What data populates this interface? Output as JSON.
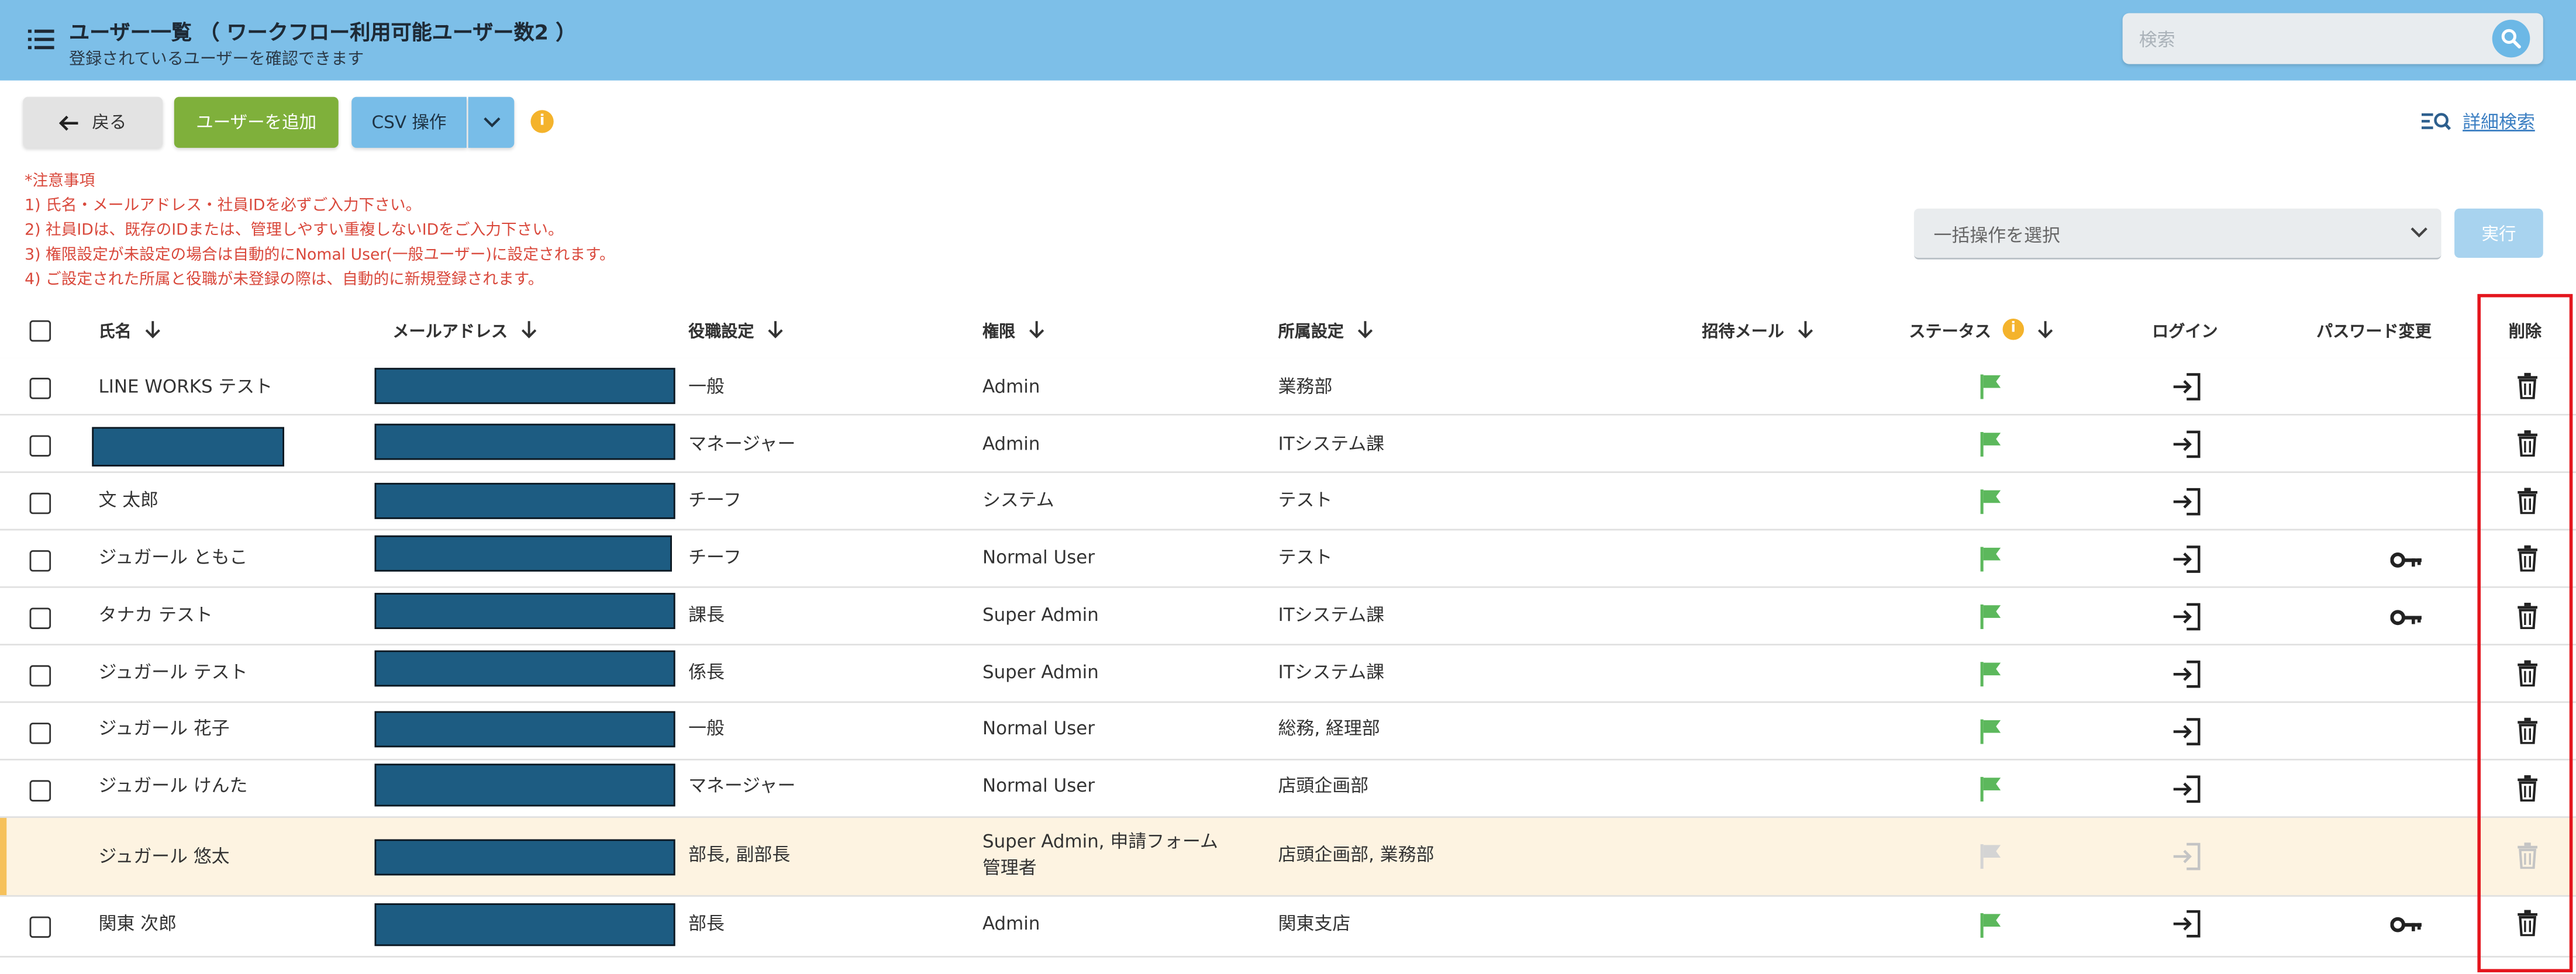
{
  "header": {
    "title": "ユーザー一覧 （ ワークフロー利用可能ユーザー数2 ）",
    "subtitle": "登録されているユーザーを確認できます",
    "search_placeholder": "検索"
  },
  "toolbar": {
    "back_label": "戻る",
    "add_user_label": "ユーザーを追加",
    "csv_label": "CSV 操作",
    "info_glyph": "i",
    "advanced_search_label": "詳細検索"
  },
  "notes": [
    "*注意事項",
    "1) 氏名・メールアドレス・社員IDを必ずご入力下さい。",
    "2) 社員IDは、既存のIDまたは、管理しやすい重複しないIDをご入力下さい。",
    "3) 権限設定が未設定の場合は自動的にNomal User(一般ユーザー)に設定されます。",
    "4) ご設定された所属と役職が未登録の際は、自動的に新規登録されます。"
  ],
  "bulk": {
    "selected": "一括操作を選択",
    "run_label": "実行"
  },
  "columns": {
    "name": "氏名",
    "email": "メールアドレス",
    "position": "役職設定",
    "role": "権限",
    "department": "所属設定",
    "invite": "招待メール",
    "status": "ステータス",
    "login": "ログイン",
    "password": "パスワード変更",
    "delete": "削除"
  },
  "rows": [
    {
      "name": "LINE WORKS テスト",
      "name_redacted": false,
      "position": "一般",
      "role": [
        "Admin"
      ],
      "department": "業務部",
      "password_key": false,
      "disabled": false
    },
    {
      "name": "",
      "name_redacted": true,
      "position": "マネージャー",
      "role": [
        "Admin"
      ],
      "department": "ITシステム課",
      "password_key": false,
      "disabled": false
    },
    {
      "name": "文 太郎",
      "name_redacted": false,
      "position": "チーフ",
      "role": [
        "システム"
      ],
      "department": "テスト",
      "password_key": false,
      "disabled": false
    },
    {
      "name": "ジュガール ともこ",
      "name_redacted": false,
      "position": "チーフ",
      "role": [
        "Normal User"
      ],
      "department": "テスト",
      "password_key": true,
      "disabled": false
    },
    {
      "name": "タナカ テスト",
      "name_redacted": false,
      "position": "課長",
      "role": [
        "Super Admin"
      ],
      "department": "ITシステム課",
      "password_key": true,
      "disabled": false
    },
    {
      "name": "ジュガール テスト",
      "name_redacted": false,
      "position": "係長",
      "role": [
        "Super Admin"
      ],
      "department": "ITシステム課",
      "password_key": false,
      "disabled": false
    },
    {
      "name": "ジュガール 花子",
      "name_redacted": false,
      "position": "一般",
      "role": [
        "Normal User"
      ],
      "department": "総務, 経理部",
      "password_key": false,
      "disabled": false
    },
    {
      "name": "ジュガール けんた",
      "name_redacted": false,
      "position": "マネージャー",
      "role": [
        "Normal User"
      ],
      "department": "店頭企画部",
      "password_key": false,
      "disabled": false
    },
    {
      "name": "ジュガール 悠太",
      "name_redacted": false,
      "position": "部長, 副部長",
      "role": [
        "Super Admin, 申請フォーム",
        "管理者"
      ],
      "department": "店頭企画部, 業務部",
      "password_key": false,
      "disabled": true
    },
    {
      "name": "関東 次郎",
      "name_redacted": false,
      "position": "部長",
      "role": [
        "Admin"
      ],
      "department": "関東支店",
      "password_key": true,
      "disabled": false
    }
  ],
  "colors": {
    "header_bg": "#7dbfe8",
    "add_button": "#7fb03b",
    "csv_button": "#78bde8",
    "status_flag": "#5cb85c",
    "notes_text": "#d9483b",
    "highlight_row": "#fdf3e1",
    "redaction": "#1d5c82",
    "annotation_frame": "#e4161e"
  },
  "icons": {
    "menu": "list-menu-icon",
    "search": "magnifier-icon",
    "back": "arrow-left-icon",
    "dropdown": "chevron-down-icon",
    "info": "info-circle-icon",
    "advanced_search": "filter-search-icon",
    "sort": "arrow-down-icon",
    "status": "flag-icon",
    "login": "login-icon",
    "password": "key-icon",
    "delete": "trash-icon"
  }
}
